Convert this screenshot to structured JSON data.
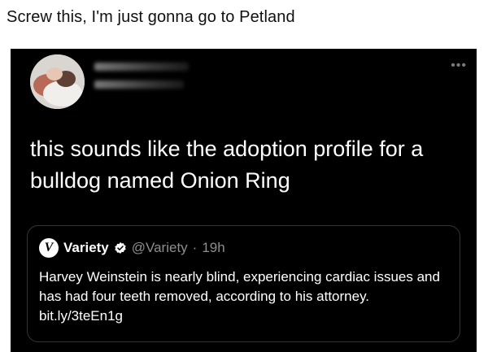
{
  "caption": "Screw this, I'm just gonna go to Petland",
  "tweet": {
    "more_icon": "more-horizontal-icon",
    "text": "this sounds like the adoption profile for a bulldog named Onion Ring",
    "quoted": {
      "author_name": "Variety",
      "handle": "@Variety",
      "separator": "·",
      "time": "19h",
      "logo_letter": "V",
      "text": "Harvey Weinstein is nearly blind, experiencing cardiac issues and has had four teeth removed, according to his attorney. bit.ly/3teEn1g"
    }
  },
  "colors": {
    "tweet_bg": "#000000",
    "meta_gray": "#8b8f93",
    "border": "#333639"
  }
}
